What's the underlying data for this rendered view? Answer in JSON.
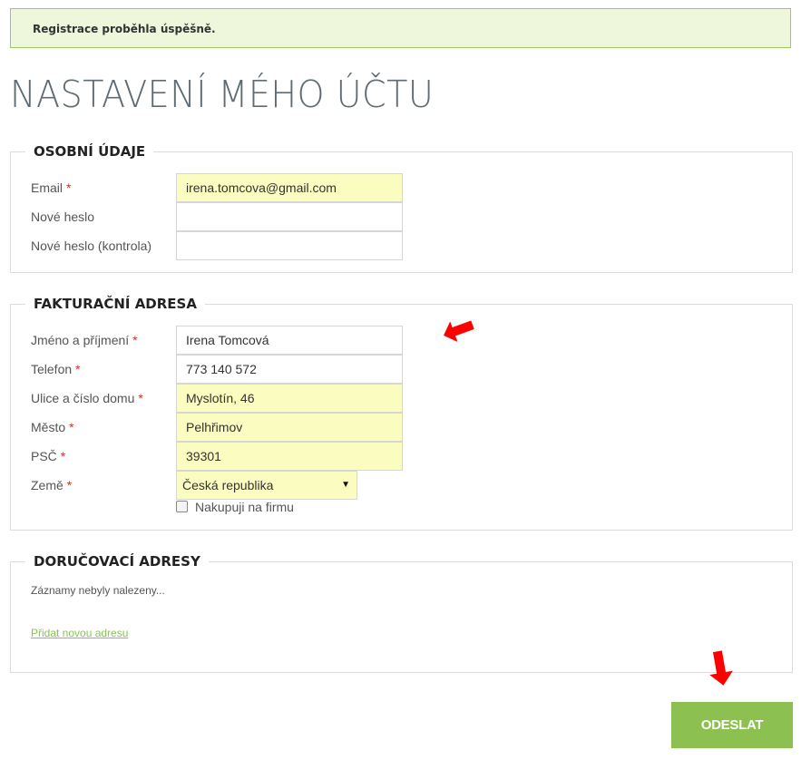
{
  "alert": {
    "message": "Registrace proběhla úspěšně."
  },
  "page": {
    "title": "NASTAVENÍ MÉHO ÚČTU"
  },
  "personal": {
    "title": "OSOBNÍ ÚDAJE",
    "email_label": "Email",
    "email_value": "irena.tomcova@gmail.com",
    "password_label": "Nové heslo",
    "password_value": "",
    "password_confirm_label": "Nové heslo (kontrola)",
    "password_confirm_value": ""
  },
  "billing": {
    "title": "FAKTURAČNÍ ADRESA",
    "name_label": "Jméno a příjmení",
    "name_value": "Irena Tomcová",
    "phone_label": "Telefon",
    "phone_value": "773 140 572",
    "street_label": "Ulice a číslo domu",
    "street_value": "Myslotín, 46",
    "city_label": "Město",
    "city_value": "Pelhřimov",
    "zip_label": "PSČ",
    "zip_value": "39301",
    "country_label": "Země",
    "country_value": "Česká republika",
    "company_checkbox_label": "Nakupuji na firmu",
    "company_checked": false
  },
  "delivery": {
    "title": "DORUČOVACÍ ADRESY",
    "empty_text": "Záznamy nebyly nalezeny...",
    "add_link": "Přidat novou adresu"
  },
  "form": {
    "required_marker": "*",
    "submit_label": "ODESLAT"
  },
  "colors": {
    "accent": "#8cc152",
    "filled_field": "#fbfdc0",
    "required": "#c0392b",
    "annotation_arrow": "#ff0000"
  },
  "icons": {
    "select_caret": "▼",
    "annotation_1": "red-arrow-icon",
    "annotation_2": "red-arrow-down-icon"
  }
}
